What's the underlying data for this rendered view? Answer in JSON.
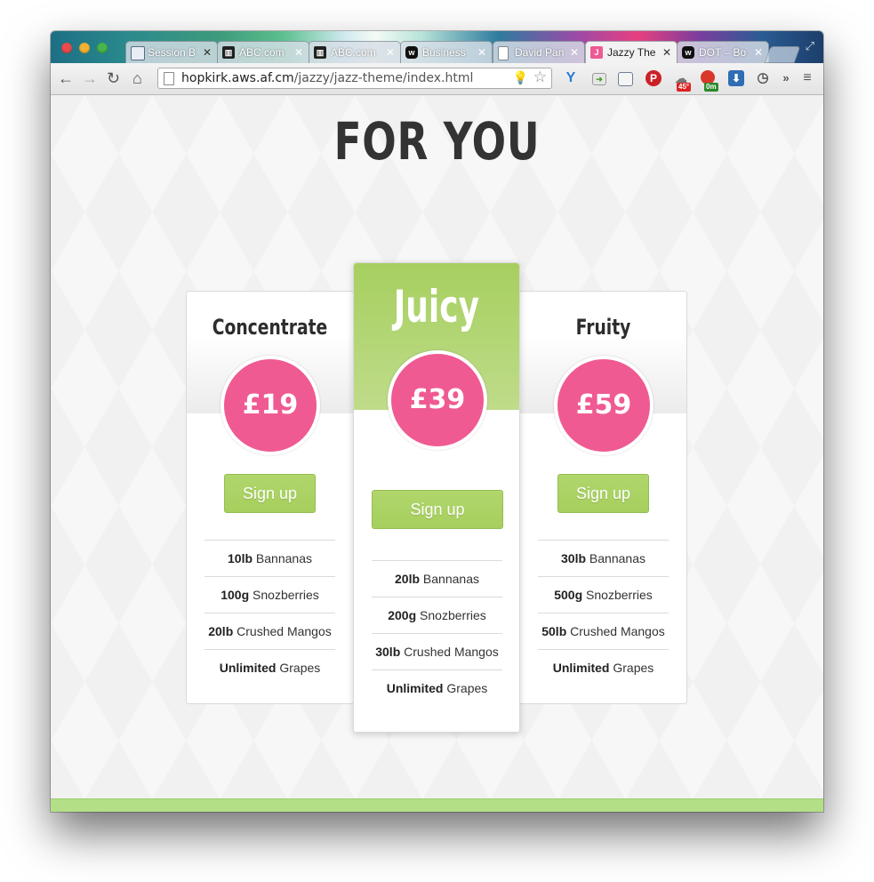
{
  "browser": {
    "tabs": [
      {
        "label": "Session B",
        "icon": "session-icon",
        "active": false
      },
      {
        "label": "ABC.com",
        "icon": "abc-icon",
        "active": false
      },
      {
        "label": "ABC.com",
        "icon": "abc-icon",
        "active": false
      },
      {
        "label": "Business",
        "icon": "w-icon",
        "active": false
      },
      {
        "label": "David Pan",
        "icon": "page-icon",
        "active": false
      },
      {
        "label": "Jazzy The",
        "icon": "jazzy-icon",
        "active": true
      },
      {
        "label": "DOT – Bo",
        "icon": "w-icon",
        "active": false
      }
    ],
    "url_host": "hopkirk.aws.af.cm",
    "url_path": "/jazzy/jazz-theme/index.html",
    "extensions": {
      "weather_badge": "45°",
      "timer_badge": "0m"
    }
  },
  "page": {
    "headline": "FOR YOU",
    "plans": [
      {
        "name": "Concentrate",
        "price": "£19",
        "signup": "Sign up",
        "features": [
          {
            "bold": "10lb",
            "text": " Bannanas"
          },
          {
            "bold": "100g",
            "text": " Snozberries"
          },
          {
            "bold": "20lb",
            "text": " Crushed Mangos"
          },
          {
            "bold": "Unlimited",
            "text": " Grapes"
          }
        ]
      },
      {
        "name": "Juicy",
        "price": "£39",
        "signup": "Sign up",
        "featured": true,
        "features": [
          {
            "bold": "20lb",
            "text": " Bannanas"
          },
          {
            "bold": "200g",
            "text": " Snozberries"
          },
          {
            "bold": "30lb",
            "text": " Crushed Mangos"
          },
          {
            "bold": "Unlimited",
            "text": " Grapes"
          }
        ]
      },
      {
        "name": "Fruity",
        "price": "£59",
        "signup": "Sign up",
        "features": [
          {
            "bold": "30lb",
            "text": " Bannanas"
          },
          {
            "bold": "500g",
            "text": " Snozberries"
          },
          {
            "bold": "50lb",
            "text": " Crushed Mangos"
          },
          {
            "bold": "Unlimited",
            "text": " Grapes"
          }
        ]
      }
    ]
  },
  "colors": {
    "accent_green": "#a6cf5d",
    "price_pink": "#ef5a92",
    "footer_green": "#b3e087"
  }
}
